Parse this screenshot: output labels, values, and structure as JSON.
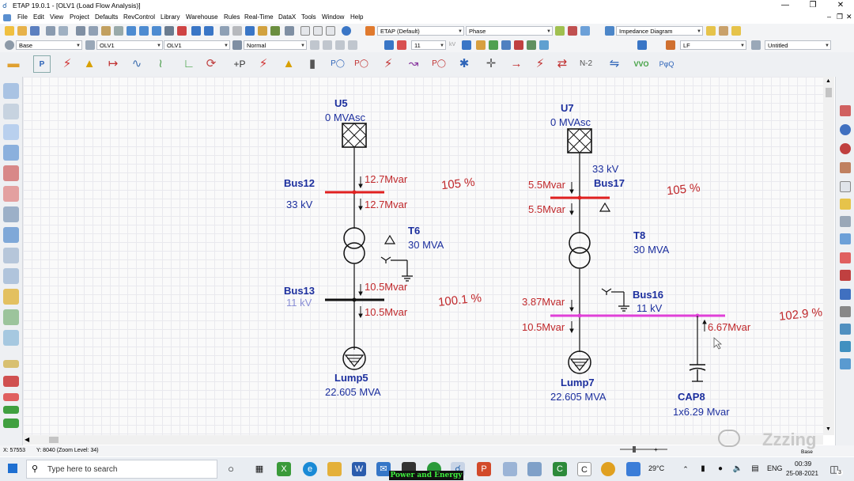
{
  "window": {
    "title": "ETAP 19.0.1 - [OLV1 (Load Flow Analysis)]"
  },
  "menu": [
    "File",
    "Edit",
    "View",
    "Project",
    "Defaults",
    "RevControl",
    "Library",
    "Warehouse",
    "Rules",
    "Real-Time",
    "DataX",
    "Tools",
    "Window",
    "Help"
  ],
  "toolbar": {
    "config": "ETAP (Default)",
    "display": "Phase",
    "diagram": "Impedance Diagram",
    "base": "Base",
    "olv_a": "OLV1",
    "olv_b": "OLV1",
    "mode": "Normal",
    "font_size": "11",
    "unit": "kV",
    "study": "LF",
    "output": "Untitled",
    "n2_label": "N-2",
    "pq_label": "+P",
    "vvo_label": "VVO",
    "pq_sym": "PφQ"
  },
  "diagram": {
    "left": {
      "source_name": "U5",
      "source_rating": "0 MVAsc",
      "bus_upper_name": "Bus12",
      "bus_upper_kv": "33 kV",
      "flow_upper_in": "12.7Mvar",
      "flow_upper_out": "12.7Mvar",
      "pct_upper": "105 %",
      "xfmr_name": "T6",
      "xfmr_rating": "30 MVA",
      "bus_lower_name": "Bus13",
      "bus_lower_kv": "11 kV",
      "flow_lower_in": "10.5Mvar",
      "flow_lower_out": "10.5Mvar",
      "pct_lower": "100.1 %",
      "load_name": "Lump5",
      "load_rating": "22.605 MVA"
    },
    "right": {
      "source_name": "U7",
      "source_rating": "0 MVAsc",
      "bus_upper_name": "Bus17",
      "bus_upper_kv": "33 kV",
      "flow_upper_in": "5.5Mvar",
      "flow_upper_out": "5.5Mvar",
      "pct_upper": "105 %",
      "xfmr_name": "T8",
      "xfmr_rating": "30 MVA",
      "bus_lower_name": "Bus16",
      "bus_lower_kv": "11 kV",
      "flow_lower_in": "3.87Mvar",
      "flow_lower_out": "10.5Mvar",
      "flow_cap": "6.67Mvar",
      "pct_lower": "102.9 %",
      "load_name": "Lump7",
      "load_rating": "22.605 MVA",
      "cap_name": "CAP8",
      "cap_rating": "1x6.29 Mvar"
    }
  },
  "status": {
    "x_coord": "X: 57553",
    "y_coord": "Y: 8040 (Zoom Level: 34)",
    "mode": "Base"
  },
  "taskbar": {
    "search_placeholder": "Type here to search",
    "temperature": "29°C",
    "language": "ENG",
    "time": "00:39",
    "date": "25-08-2021",
    "notification_count": "3",
    "banner": "Power and Energy"
  },
  "watermark": "Zzzing",
  "colors": {
    "bus_upper_left": "#e02020",
    "bus_upper_right": "#e02020",
    "bus_lower_left": "#111111",
    "bus_lower_right": "#e040d8",
    "label_blue": "#1c2f9e",
    "label_red": "#c0282b"
  }
}
